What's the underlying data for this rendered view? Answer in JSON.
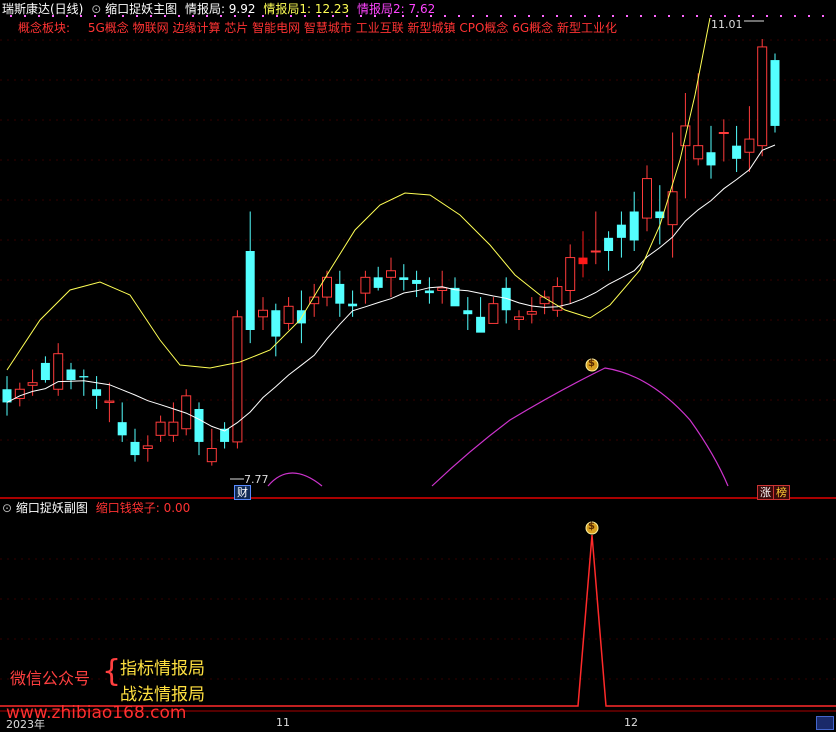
{
  "colors": {
    "bg": "#000000",
    "up": "#ff3b3b",
    "down": "#54ffff",
    "ma_white": "#ffffff",
    "band_yellow": "#ffff55",
    "band_magenta": "#cc33cc",
    "signal_red": "#ff2a2a",
    "divider": "#aa0000",
    "grid": "#660000"
  },
  "main": {
    "stock_name": "瑞斯康达(日线)",
    "panel_title": "缩口捉妖主图",
    "ind1_label": "情报局: 9.92",
    "ind2_label": "情报局1: 12.23",
    "ind3_label": "情报局2: 7.62",
    "concept_label": "概念板块:",
    "concepts": "5G概念 物联网 边缘计算 芯片 智能电网 智慧城市 工业互联 新型城镇 CPO概念 6G概念 新型工业化",
    "high_label": "11.01",
    "low_label": "7.77",
    "cai_badge": "财",
    "zhang_badge": "涨",
    "bang_badge": "榜",
    "money_icon_text": "$"
  },
  "sub": {
    "panel_title": "缩口捉妖副图",
    "indicator_label": "缩口钱袋子: 0.00"
  },
  "watermark": {
    "wechat_label": "微信公众号",
    "brace": "{",
    "line1": "指标情报局",
    "line2": "战法情报局",
    "site": "www.zhibiao168.com"
  },
  "axis": {
    "year": "2023年",
    "m11": "11",
    "m12": "12"
  },
  "chart_data": {
    "type": "candlestick",
    "ohlc": [
      [
        8.35,
        8.45,
        8.15,
        8.25
      ],
      [
        8.28,
        8.4,
        8.22,
        8.35
      ],
      [
        8.38,
        8.5,
        8.3,
        8.4
      ],
      [
        8.55,
        8.6,
        8.4,
        8.42
      ],
      [
        8.35,
        8.7,
        8.3,
        8.62
      ],
      [
        8.5,
        8.55,
        8.35,
        8.42
      ],
      [
        8.45,
        8.5,
        8.3,
        8.44
      ],
      [
        8.35,
        8.45,
        8.2,
        8.3
      ],
      [
        8.25,
        8.4,
        8.1,
        8.26
      ],
      [
        8.1,
        8.25,
        7.95,
        8.0
      ],
      [
        7.95,
        8.05,
        7.8,
        7.85
      ],
      [
        7.9,
        8.0,
        7.8,
        7.92
      ],
      [
        8.0,
        8.15,
        7.95,
        8.1
      ],
      [
        8.0,
        8.25,
        7.95,
        8.1
      ],
      [
        8.05,
        8.35,
        8.0,
        8.3
      ],
      [
        8.2,
        8.25,
        7.85,
        7.95
      ],
      [
        7.8,
        8.05,
        7.77,
        7.9
      ],
      [
        8.05,
        8.1,
        7.9,
        7.95
      ],
      [
        7.95,
        8.95,
        7.9,
        8.9
      ],
      [
        9.4,
        9.7,
        8.7,
        8.8
      ],
      [
        8.9,
        9.05,
        8.8,
        8.95
      ],
      [
        8.95,
        9.0,
        8.6,
        8.75
      ],
      [
        8.85,
        9.05,
        8.8,
        8.98
      ],
      [
        8.95,
        9.1,
        8.7,
        8.85
      ],
      [
        9.0,
        9.15,
        8.9,
        9.05
      ],
      [
        9.05,
        9.25,
        8.98,
        9.2
      ],
      [
        9.15,
        9.25,
        8.9,
        9.0
      ],
      [
        9.0,
        9.1,
        8.9,
        8.98
      ],
      [
        9.08,
        9.25,
        9.0,
        9.2
      ],
      [
        9.2,
        9.28,
        9.1,
        9.12
      ],
      [
        9.2,
        9.35,
        9.05,
        9.25
      ],
      [
        9.2,
        9.3,
        9.1,
        9.18
      ],
      [
        9.18,
        9.25,
        9.05,
        9.15
      ],
      [
        9.1,
        9.2,
        9.0,
        9.08
      ],
      [
        9.1,
        9.25,
        9.0,
        9.12
      ],
      [
        9.12,
        9.2,
        9.0,
        8.98
      ],
      [
        8.95,
        9.05,
        8.8,
        8.92
      ],
      [
        8.9,
        9.05,
        8.8,
        8.78
      ],
      [
        8.85,
        9.05,
        8.85,
        9.0
      ],
      [
        9.12,
        9.2,
        8.85,
        8.95
      ],
      [
        8.88,
        8.95,
        8.8,
        8.9
      ],
      [
        8.92,
        9.05,
        8.85,
        8.94
      ],
      [
        9.0,
        9.1,
        8.92,
        9.05
      ],
      [
        8.95,
        9.2,
        8.9,
        9.13
      ],
      [
        9.1,
        9.45,
        9.0,
        9.35
      ],
      [
        9.3,
        9.55,
        9.2,
        9.35
      ],
      [
        9.4,
        9.7,
        9.3,
        9.4
      ],
      [
        9.5,
        9.55,
        9.25,
        9.4
      ],
      [
        9.6,
        9.7,
        9.35,
        9.5
      ],
      [
        9.7,
        9.85,
        9.4,
        9.48
      ],
      [
        9.65,
        10.05,
        9.55,
        9.95
      ],
      [
        9.7,
        9.9,
        9.45,
        9.65
      ],
      [
        9.6,
        10.3,
        9.35,
        9.85
      ],
      [
        10.2,
        10.6,
        9.8,
        10.35
      ],
      [
        10.1,
        10.75,
        10.05,
        10.2
      ],
      [
        10.15,
        10.35,
        9.95,
        10.05
      ],
      [
        10.3,
        10.4,
        10.08,
        10.3
      ],
      [
        10.2,
        10.35,
        10.0,
        10.1
      ],
      [
        10.15,
        10.5,
        10.0,
        10.25
      ],
      [
        10.2,
        11.01,
        10.12,
        10.95
      ],
      [
        10.85,
        10.9,
        10.3,
        10.35
      ]
    ]
  }
}
